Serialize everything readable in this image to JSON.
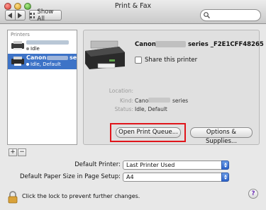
{
  "window": {
    "title": "Print & Fax"
  },
  "toolbar": {
    "show_all_label": "Show All",
    "search_placeholder": ""
  },
  "printers": {
    "header": "Printers",
    "items": [
      {
        "name": "",
        "status": "Idle"
      },
      {
        "name": "Canon",
        "name_suffix": "se",
        "status": "Idle, Default"
      }
    ]
  },
  "detail": {
    "printer_name_prefix": "Canon",
    "printer_name_suffix": "series _F2E1CFF48265",
    "share_label": "Share this printer",
    "location_label": "Location:",
    "location_value": "",
    "kind_label": "Kind:",
    "kind_value_prefix": "Canon",
    "kind_value_suffix": "series",
    "status_label": "Status:",
    "status_value": "Idle, Default",
    "open_queue_label": "Open Print Queue...",
    "options_label": "Options & Supplies..."
  },
  "list_controls": {
    "add_label": "+",
    "remove_label": "−"
  },
  "settings": {
    "default_printer_label": "Default Printer:",
    "default_printer_value": "Last Printer Used",
    "paper_size_label": "Default Paper Size in Page Setup:",
    "paper_size_value": "A4"
  },
  "footer": {
    "lock_text": "Click the lock to prevent further changes.",
    "help_label": "?"
  },
  "colors": {
    "selection": "#3d73c7",
    "highlight_box": "#e0151b",
    "select_arrow": "#2c62c9"
  }
}
